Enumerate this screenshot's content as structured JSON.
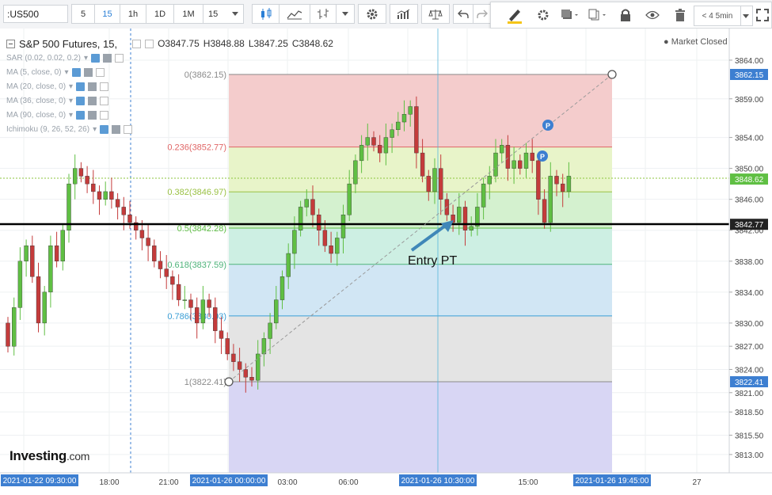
{
  "toolbar": {
    "symbol": ":US500",
    "intervals": [
      "5",
      "15",
      "1h",
      "1D",
      "1M",
      "15"
    ],
    "active_interval_index": 1,
    "interval_dropdown_right": "< 4 5min",
    "active_color": "#2a7fd6"
  },
  "legend": {
    "title": "S&P 500 Futures, 15,",
    "open": "O3847.75",
    "high": "H3848.88",
    "low": "L3847.25",
    "close": "C3848.62",
    "indicators": [
      "SAR (0.02, 0.02, 0.2)",
      "MA (5, close, 0)",
      "MA (20, close, 0)",
      "MA (36, close, 0)",
      "MA (90, close, 0)",
      "Ichimoku (9, 26, 52, 26)"
    ]
  },
  "market_status": "Market Closed",
  "logo": {
    "name": "Investing",
    "suffix": ".com"
  },
  "annotation": "Entry PT",
  "price_axis": {
    "ticks": [
      "3864.00",
      "3859.00",
      "3854.00",
      "3850.00",
      "3846.00",
      "3842.00",
      "3838.00",
      "3834.00",
      "3830.00",
      "3827.00",
      "3824.00",
      "3821.00",
      "3818.50",
      "3815.50",
      "3813.00"
    ],
    "markers": [
      {
        "label": "3862.15",
        "bg": "#3d7fd1"
      },
      {
        "label": "3848.62",
        "bg": "#5fbf43"
      },
      {
        "label": "3842.77",
        "bg": "#222222"
      },
      {
        "label": "3822.41",
        "bg": "#3d7fd1"
      }
    ]
  },
  "time_axis": {
    "ticks": [
      "18:00",
      "21:00",
      "03:00",
      "06:00",
      "15:00",
      "27"
    ],
    "highlighted": [
      "2021-01-22 09:30:00",
      "2021-01-26 00:00:00",
      "2021-01-26 10:30:00",
      "2021-01-26 19:45:00"
    ],
    "highlight_color": "#3d7fd1"
  },
  "fib_levels": [
    {
      "label": "0(3862.15)",
      "color": "#8a8a8a",
      "fill": "#f4cccc"
    },
    {
      "label": "0.236(3852.77)",
      "color": "#e06666",
      "fill": "#e8f4c9"
    },
    {
      "label": "0.382(3846.97)",
      "color": "#9ac144",
      "fill": "#d4f1cf"
    },
    {
      "label": "0.5(3842.28)",
      "color": "#5fbf43",
      "fill": "#cdefe3"
    },
    {
      "label": "0.618(3837.59)",
      "color": "#4eb37a",
      "fill": "#d1e6f4"
    },
    {
      "label": "0.786(3830.93)",
      "color": "#3a9ed6",
      "fill": "#e4e4e4"
    },
    {
      "label": "1(3822.41)",
      "color": "#8a8a8a",
      "fill": "#d8d6f4"
    }
  ],
  "colors": {
    "up": "#5fbf43",
    "down": "#c43b3b"
  }
}
